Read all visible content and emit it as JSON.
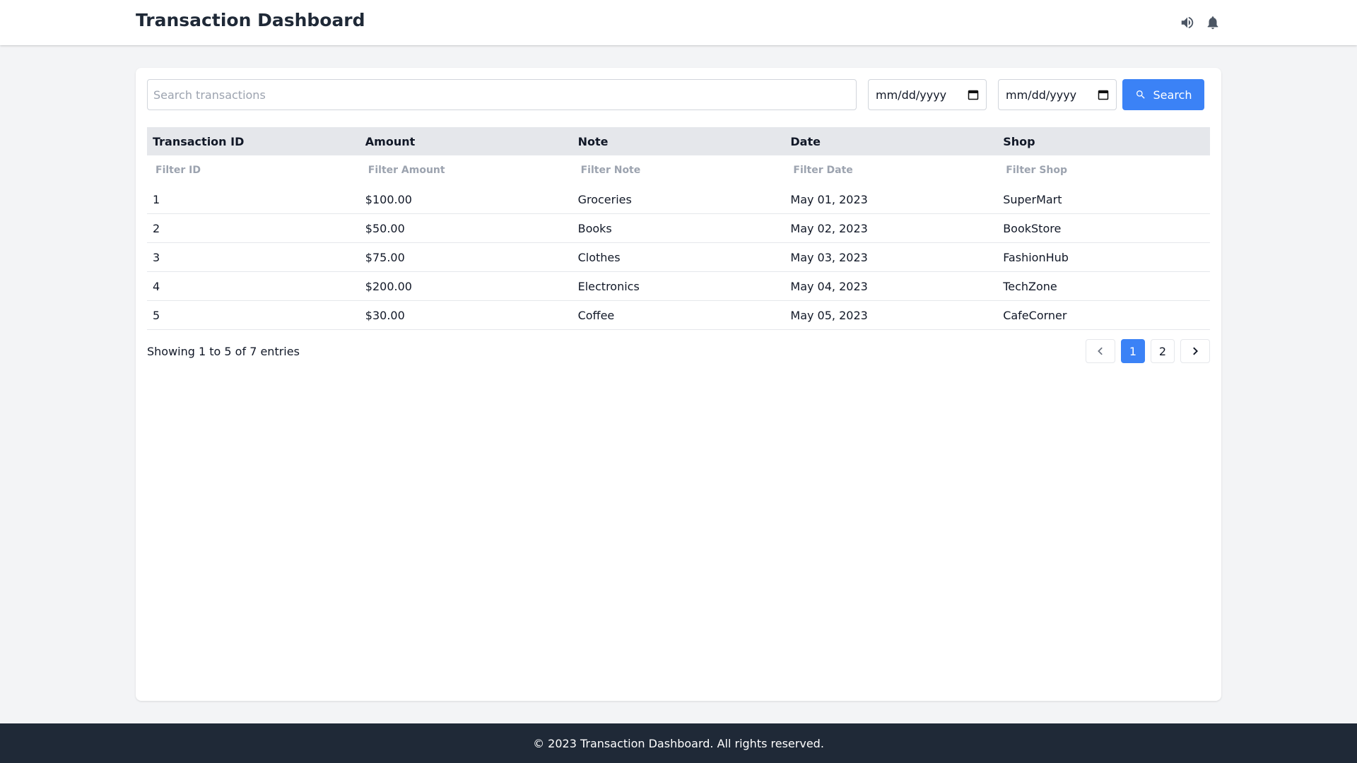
{
  "header": {
    "title": "Transaction Dashboard",
    "icons": [
      "speaker-icon",
      "bell-icon"
    ]
  },
  "search": {
    "placeholder": "Search transactions",
    "value": "",
    "date_from": "mm/dd/yyyy",
    "date_to": "mm/dd/yyyy",
    "button_label": "Search"
  },
  "table": {
    "columns": [
      "Transaction ID",
      "Amount",
      "Note",
      "Date",
      "Shop"
    ],
    "filters": [
      "Filter ID",
      "Filter Amount",
      "Filter Note",
      "Filter Date",
      "Filter Shop"
    ],
    "rows": [
      [
        "1",
        "$100.00",
        "Groceries",
        "May 01, 2023",
        "SuperMart"
      ],
      [
        "2",
        "$50.00",
        "Books",
        "May 02, 2023",
        "BookStore"
      ],
      [
        "3",
        "$75.00",
        "Clothes",
        "May 03, 2023",
        "FashionHub"
      ],
      [
        "4",
        "$200.00",
        "Electronics",
        "May 04, 2023",
        "TechZone"
      ],
      [
        "5",
        "$30.00",
        "Coffee",
        "May 05, 2023",
        "CafeCorner"
      ]
    ]
  },
  "pagination": {
    "info": "Showing 1 to 5 of 7 entries",
    "pages": [
      "1",
      "2"
    ],
    "active_page": "1"
  },
  "footer": {
    "text": "© 2023 Transaction Dashboard. All rights reserved."
  },
  "colors": {
    "accent": "#3b82f6",
    "footer_bg": "#1f2937",
    "page_bg": "#f3f4f6"
  }
}
